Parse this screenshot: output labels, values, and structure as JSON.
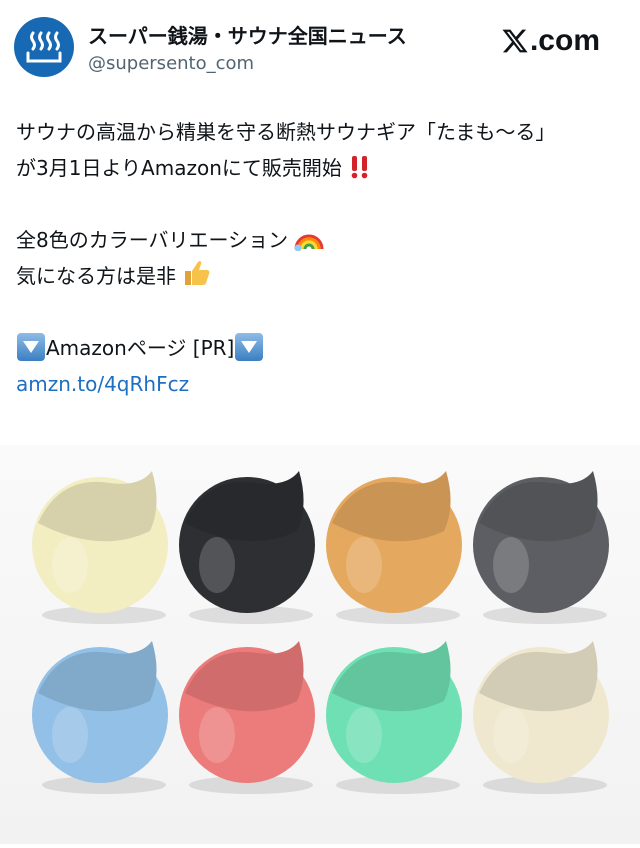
{
  "account": {
    "display_name": "スーパー銭湯・サウナ全国ニュース",
    "handle": "@supersento_com",
    "avatar_icon": "hot-spring-icon",
    "brand_color": "#1769b3"
  },
  "site_logo": {
    "letter_icon": "x-logo-icon",
    "domain_text": ".com"
  },
  "tweet": {
    "line1": "サウナの高温から精巣を守る断熱サウナギア「たまも〜る」",
    "line2_text": "が3月1日よりAmazonにて販売開始",
    "line2_emoji": "double-exclamation-icon",
    "line3_text": "全8色のカラーバリエーション",
    "line3_emoji": "rainbow-icon",
    "line4_text": "気になる方は是非",
    "line4_emoji": "thumbs-up-icon",
    "line5_text": "Amazonページ [PR]",
    "line5_emoji": "down-arrow-box-icon",
    "link": "amzn.to/4qRhFcz",
    "link_color": "#1d6fc2"
  },
  "product_photo": {
    "cup_colors": [
      "#f3edc2",
      "#2e2f33",
      "#e5a85f",
      "#5c5e63",
      "#93c0e6",
      "#ec7b7b",
      "#6fe0b4",
      "#efe8cf"
    ]
  }
}
